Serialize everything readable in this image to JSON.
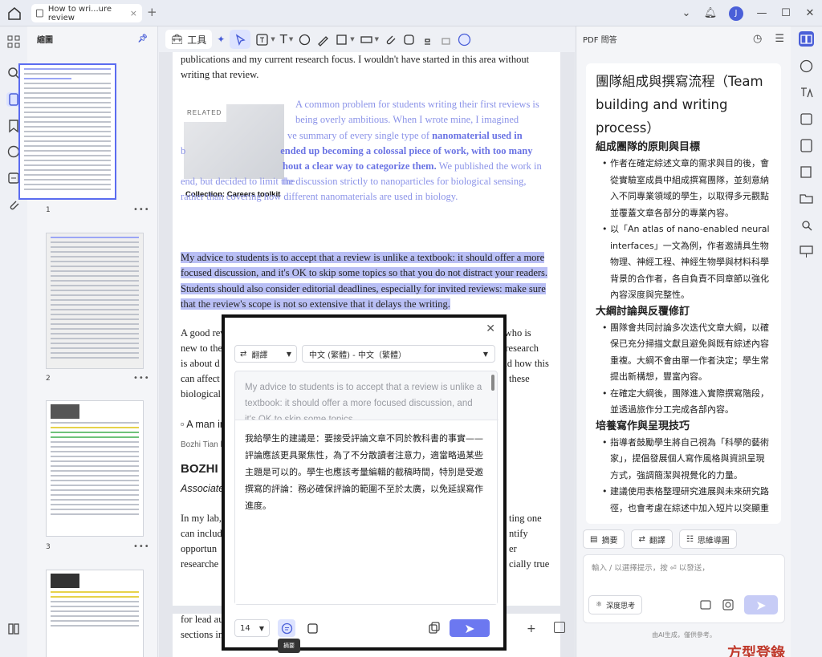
{
  "titlebar": {
    "tab_title": "How to wri...ure review",
    "close_glyph": "×",
    "plus_glyph": "+",
    "avatar_letter": "J"
  },
  "thumbnails": {
    "title": "縮圖",
    "pages": [
      {
        "num": "1",
        "menu": "•••"
      },
      {
        "num": "2",
        "menu": "•••"
      },
      {
        "num": "3",
        "menu": "•••"
      }
    ]
  },
  "toolbar": {
    "tools_label": "工具"
  },
  "document": {
    "para_top": "publications and my current research focus. I wouldn't have started in this area without writing that review.",
    "related_tag": "RELATED",
    "related_caption": "Collection: Careers toolkit",
    "faded_1": "A common problem for students writing their first reviews is being overly ambitious. When I wrote mine, I imagined",
    "faded_2": "ve summary of every single type of",
    "faded_2b": "nanomaterial used in",
    "faded_3": "b",
    "faded_3b": "ended up",
    "faded_3c": "becoming a colossal piece of work, with too many",
    "faded_4": "hout a clear way to categorize them.",
    "faded_4b": "We published the work in the",
    "faded_5": "end, but decided to limit the discussion strictly to nanoparticles for biological sensing,",
    "faded_6": "rather than covering how different nanomaterials are used in biology.",
    "highlight": "My advice to students is to accept that a review is unlike a textbook: it should offer a more focused discussion, and it's OK to skip some topics so that you do not distract your readers. Students should also consider editorial deadlines, especially for invited reviews: make sure that the review's scope is not so extensive that it delays the writing.",
    "partial_1": "A good rev",
    "partial_1r": "e who is",
    "partial_2": "new to the",
    "partial_2r": "y research",
    "partial_3": "is about d",
    "partial_3r": "and how this",
    "partial_4": "can affect",
    "partial_4r": "these",
    "partial_5": "biological",
    "img_alt": "A man in",
    "img_credit": "Bozhi Tian l",
    "heading": "BOZHI T",
    "subhead": "Associate p",
    "partial_6": "In my lab,",
    "partial_6r": "ting one",
    "partial_7": "can includ",
    "partial_7r": "ntify",
    "partial_8": "opportun",
    "partial_8r": "er",
    "partial_9": "researche",
    "partial_9r": "cially true",
    "bottom_1": "for lead au",
    "bottom_2": "sections in"
  },
  "translate_popup": {
    "mode": "翻譯",
    "language": "中文 (繁體) - 中文（繁體）",
    "source": "My advice to students is to accept that a review is unlike a textbook: it should offer a more focused discussion, and it's OK to skip some topics",
    "output": "我給學生的建議是：要接受評論文章不同於教科書的事實——評論應該更具聚焦性，為了不分散讀者注意力，適當略過某些主題是可以的。學生也應該考量編輯的截稿時間，特別是受邀撰寫的評論：務必確保評論的範圍不至於太廣，以免延誤寫作進度。",
    "font_size": "14",
    "tooltip": "摘要"
  },
  "pdf_ai": {
    "title": "PDF 問答",
    "answer_title": "團隊組成與撰寫流程（Team building and writing process）",
    "sections": [
      {
        "heading": "組成團隊的原則與目標",
        "bullets": [
          "作者在確定綜述文章的需求與目的後，會從實驗室成員中組成撰寫團隊，並刻意納入不同專業領域的學生，以取得多元觀點並覆蓋文章各部分的專業內容。",
          "以「An atlas of nano-enabled neural interfaces」一文為例，作者邀請具生物物理、神經工程、神經生物學與材料科學背景的合作者，各自負責不同章節以強化內容深度與完整性。"
        ]
      },
      {
        "heading": "大綱討論與反覆修訂",
        "bullets": [
          "團隊會共同討論多次迭代文章大綱，以確保已充分掃描文獻且避免與既有綜述內容重複。大綱不會由單一作者決定；學生常提出新構想，豐富內容。",
          "在確定大綱後，團隊進入實際撰寫階段，並透過旅作分工完成各部內容。"
        ]
      },
      {
        "heading": "培養寫作與呈現技巧",
        "bullets": [
          "指導者鼓勵學生將自己視為「科學的藝術家」，提倡發展個人寫作風格與資訊呈現方式，強調簡潔與視覺化的力量。",
          "建議使用表格整理研究進展與未來研究路徑，也會考慮在綜述中加入短片以突顯重"
        ]
      }
    ],
    "actions": [
      "摘要",
      "翻譯",
      "思維導圖"
    ],
    "input_placeholder": "輸入 / 以選擇提示，按 ⏎ 以發送，",
    "deep_think": "深度思考",
    "disclaimer": "由AI生成，僅供參考。"
  },
  "promo_text": "方型登錄",
  "colors": {
    "accent": "#5b6cf0",
    "highlight": "#b9bff5",
    "faded_text": "#8b93e8"
  }
}
